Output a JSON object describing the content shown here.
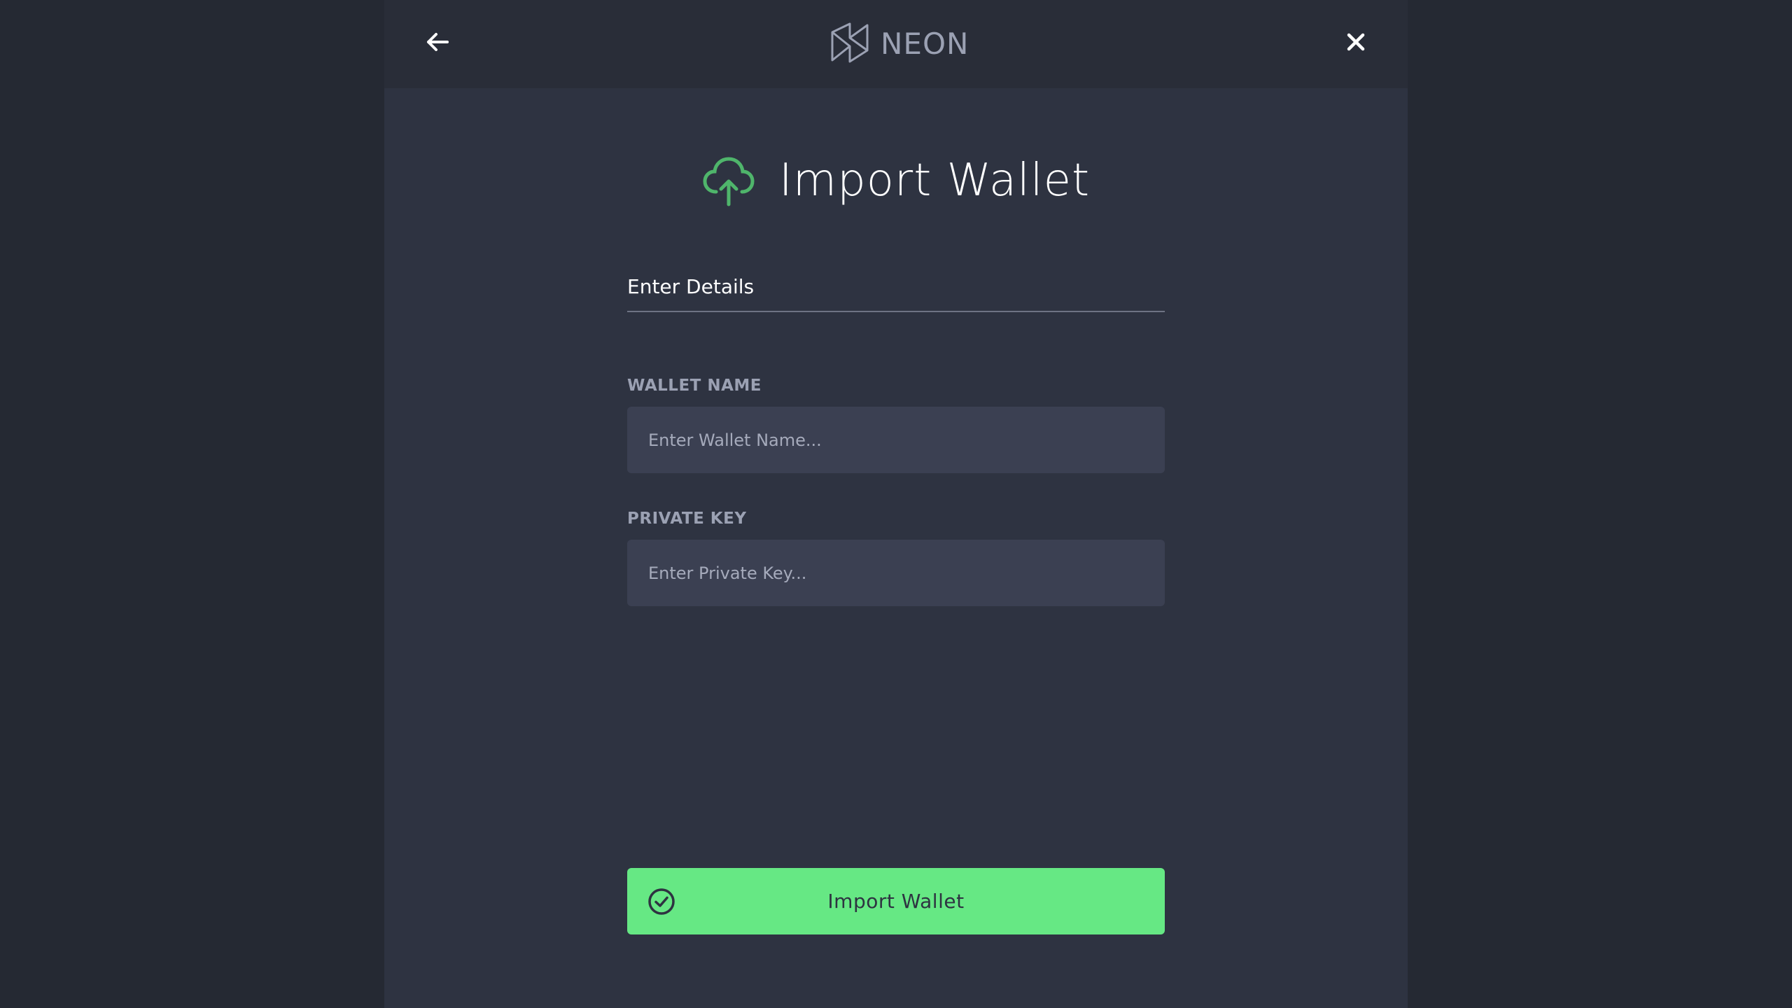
{
  "header": {
    "brand_name": "NEON",
    "back_icon": "arrow-left-icon",
    "close_icon": "close-icon",
    "logo_icon": "neon-logo-icon"
  },
  "main": {
    "title": "Import Wallet",
    "title_icon": "cloud-upload-icon",
    "section_title": "Enter Details",
    "fields": [
      {
        "label": "WALLET NAME",
        "placeholder": "Enter Wallet Name...",
        "value": ""
      },
      {
        "label": "PRIVATE KEY",
        "placeholder": "Enter Private Key...",
        "value": ""
      }
    ],
    "submit_label": "Import Wallet",
    "submit_icon": "check-circle-icon"
  },
  "colors": {
    "accent_green": "#66e884",
    "icon_green": "#4fb56b",
    "panel_bg": "#2e3341",
    "outer_bg": "#252933",
    "input_bg": "#3b4052"
  }
}
